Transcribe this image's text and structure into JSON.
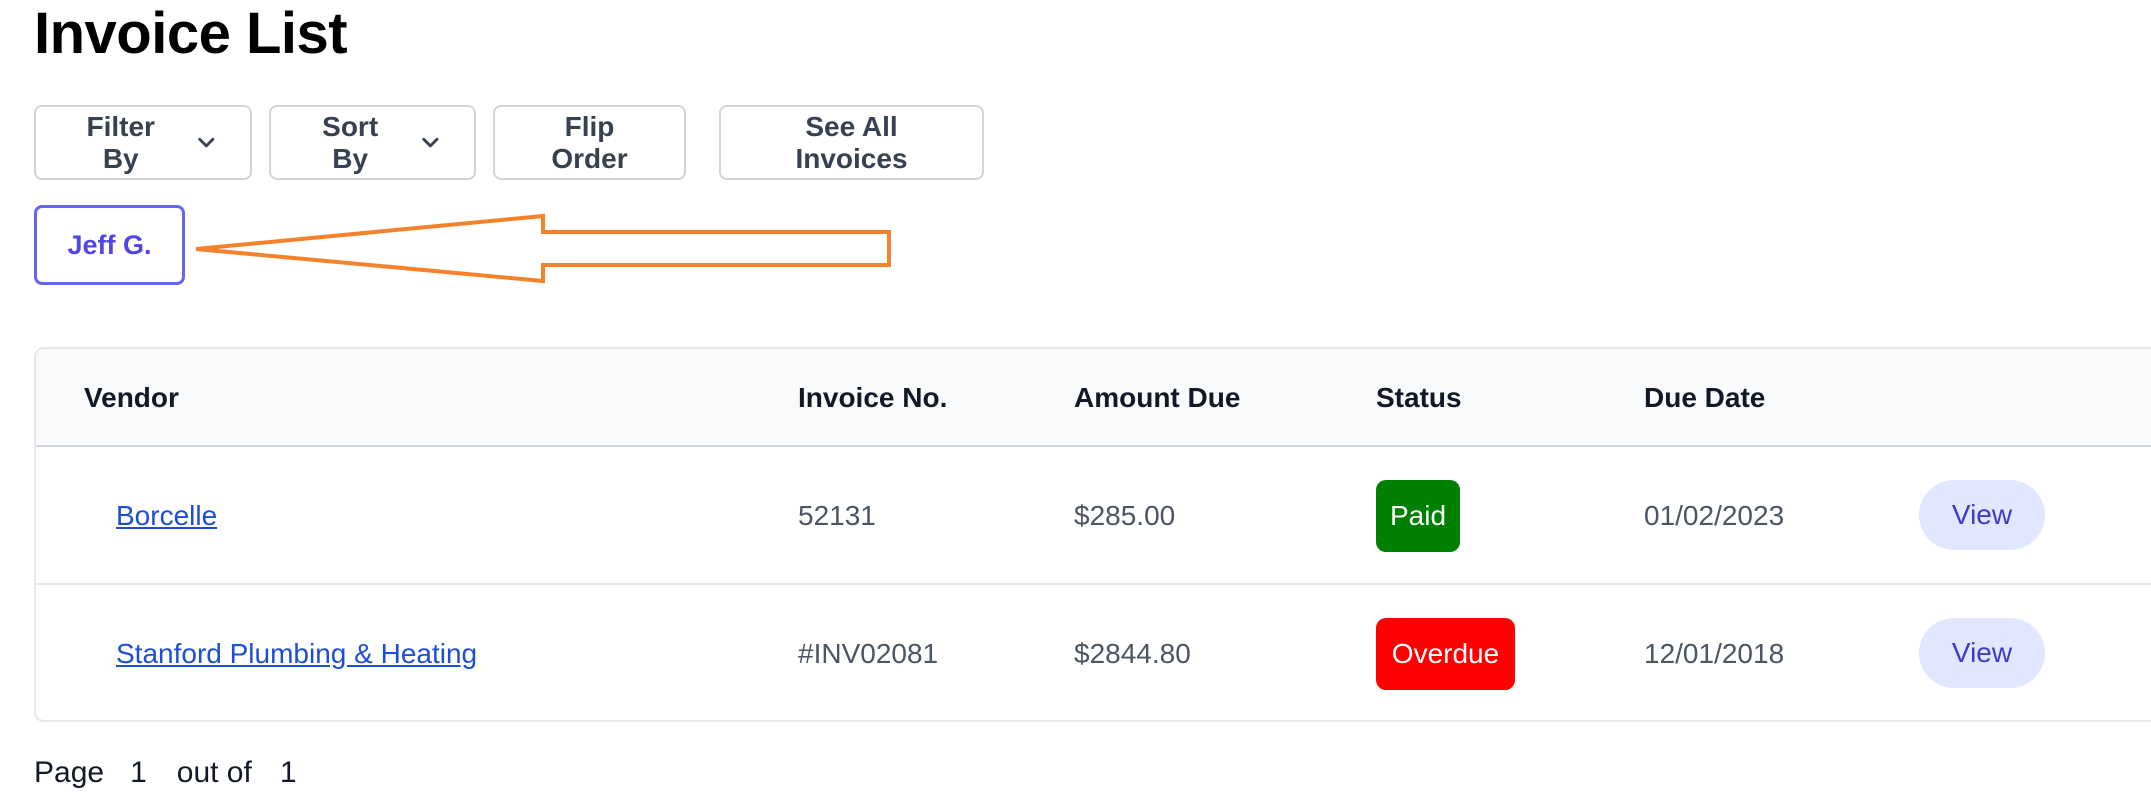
{
  "page": {
    "title": "Invoice List"
  },
  "toolbar": {
    "filter_label": "Filter By",
    "sort_label": "Sort By",
    "flip_label": "Flip Order",
    "all_label": "See All Invoices"
  },
  "active_filter": {
    "label": "Jeff G."
  },
  "annotation": {
    "color": "#f5822a"
  },
  "table": {
    "headers": {
      "vendor": "Vendor",
      "invoice_no": "Invoice No.",
      "amount_due": "Amount Due",
      "status": "Status",
      "due_date": "Due Date"
    },
    "rows": [
      {
        "vendor": "Borcelle",
        "invoice_no": "52131",
        "amount_due": "$285.00",
        "status": "Paid",
        "status_color": "#008000",
        "due_date": "01/02/2023",
        "action": "View"
      },
      {
        "vendor": "Stanford Plumbing & Heating",
        "invoice_no": "#INV02081",
        "amount_due": "$2844.80",
        "status": "Overdue",
        "status_color": "#ff0000",
        "due_date": "12/01/2018",
        "action": "View"
      }
    ]
  },
  "pagination": {
    "page_label": "Page",
    "current": "1",
    "of_label": "out of",
    "total": "1"
  },
  "colors": {
    "accent": "#4f46e5",
    "link": "#1d4ed8",
    "view_bg": "#e0e7ff"
  },
  "icons": {
    "dropdown": "chevron-down-icon"
  }
}
